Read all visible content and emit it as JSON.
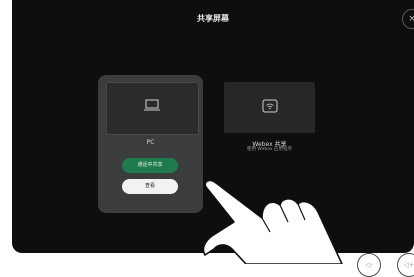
{
  "header": {
    "title": "共享屏幕",
    "close_icon": "close-icon",
    "close_glyph": "×"
  },
  "cards": {
    "pc": {
      "label": "PC",
      "icon": "laptop-icon"
    },
    "webex": {
      "label": "Webex 共享",
      "sublabel": "使用 Webex 应用程序",
      "icon": "wireless-share-icon"
    }
  },
  "actions": {
    "share_in_call": "通话中共享",
    "view": "查看"
  },
  "volume": {
    "down_glyph": "◁-",
    "up_glyph": "◁+"
  },
  "colors": {
    "background": "#0d0e0f",
    "card": "#3a3c3e",
    "share_button": "#1f7a4d",
    "view_button": "#f2f2f2"
  }
}
